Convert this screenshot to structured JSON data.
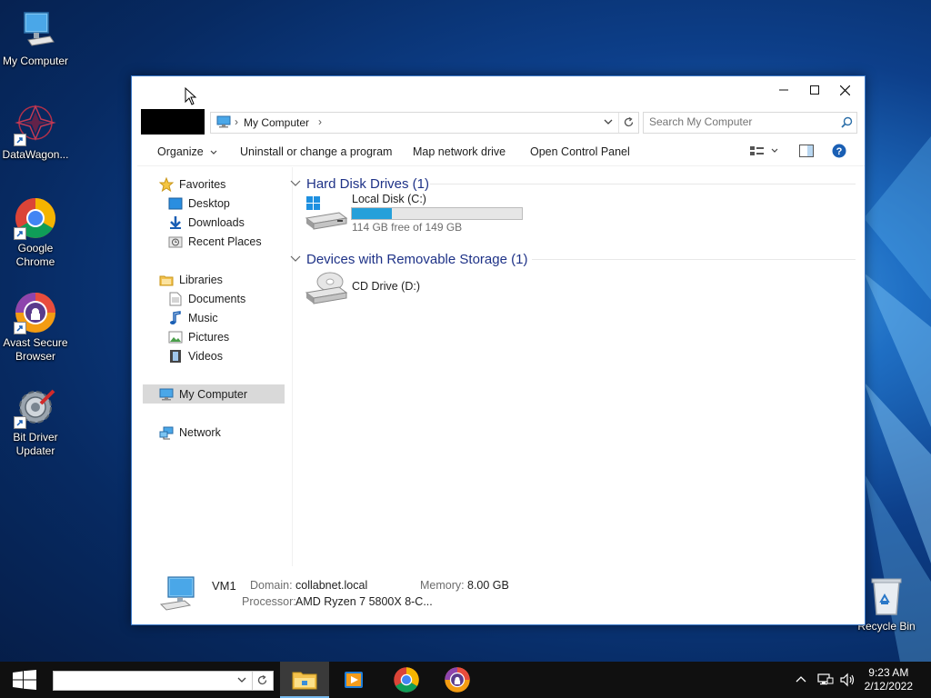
{
  "desktop": {
    "icons": [
      {
        "label": "My Computer"
      },
      {
        "label": "DataWagon..."
      },
      {
        "label": "Google Chrome"
      },
      {
        "label": "Avast Secure Browser"
      },
      {
        "label": "Bit Driver Updater"
      },
      {
        "label": "Recycle Bin"
      }
    ]
  },
  "window": {
    "address": {
      "crumb": "My Computer"
    },
    "search": {
      "placeholder": "Search My Computer"
    },
    "toolbar": {
      "organize": "Organize",
      "uninstall": "Uninstall or change a program",
      "map_drive": "Map network drive",
      "control_panel": "Open Control Panel"
    },
    "nav": {
      "favorites": "Favorites",
      "desktop": "Desktop",
      "downloads": "Downloads",
      "recent": "Recent Places",
      "libraries": "Libraries",
      "documents": "Documents",
      "music": "Music",
      "pictures": "Pictures",
      "videos": "Videos",
      "computer": "My Computer",
      "network": "Network"
    },
    "groups": {
      "hdd": "Hard Disk Drives (1)",
      "removable": "Devices with Removable Storage (1)"
    },
    "drives": {
      "c": {
        "name": "Local Disk (C:)",
        "free": "114 GB free of 149 GB",
        "used_fraction": 0.235
      },
      "d": {
        "name": "CD Drive (D:)"
      }
    },
    "details": {
      "name": "VM1",
      "domain_label": "Domain:",
      "domain": "collabnet.local",
      "memory_label": "Memory:",
      "memory": "8.00 GB",
      "processor_label": "Processor:",
      "processor": "AMD Ryzen 7 5800X 8-C..."
    }
  },
  "taskbar": {
    "time": "9:23 AM",
    "date": "2/12/2022"
  },
  "colors": {
    "accent": "#26a0da",
    "group_heading": "#1e3287",
    "selection": "#d9d9d9"
  }
}
